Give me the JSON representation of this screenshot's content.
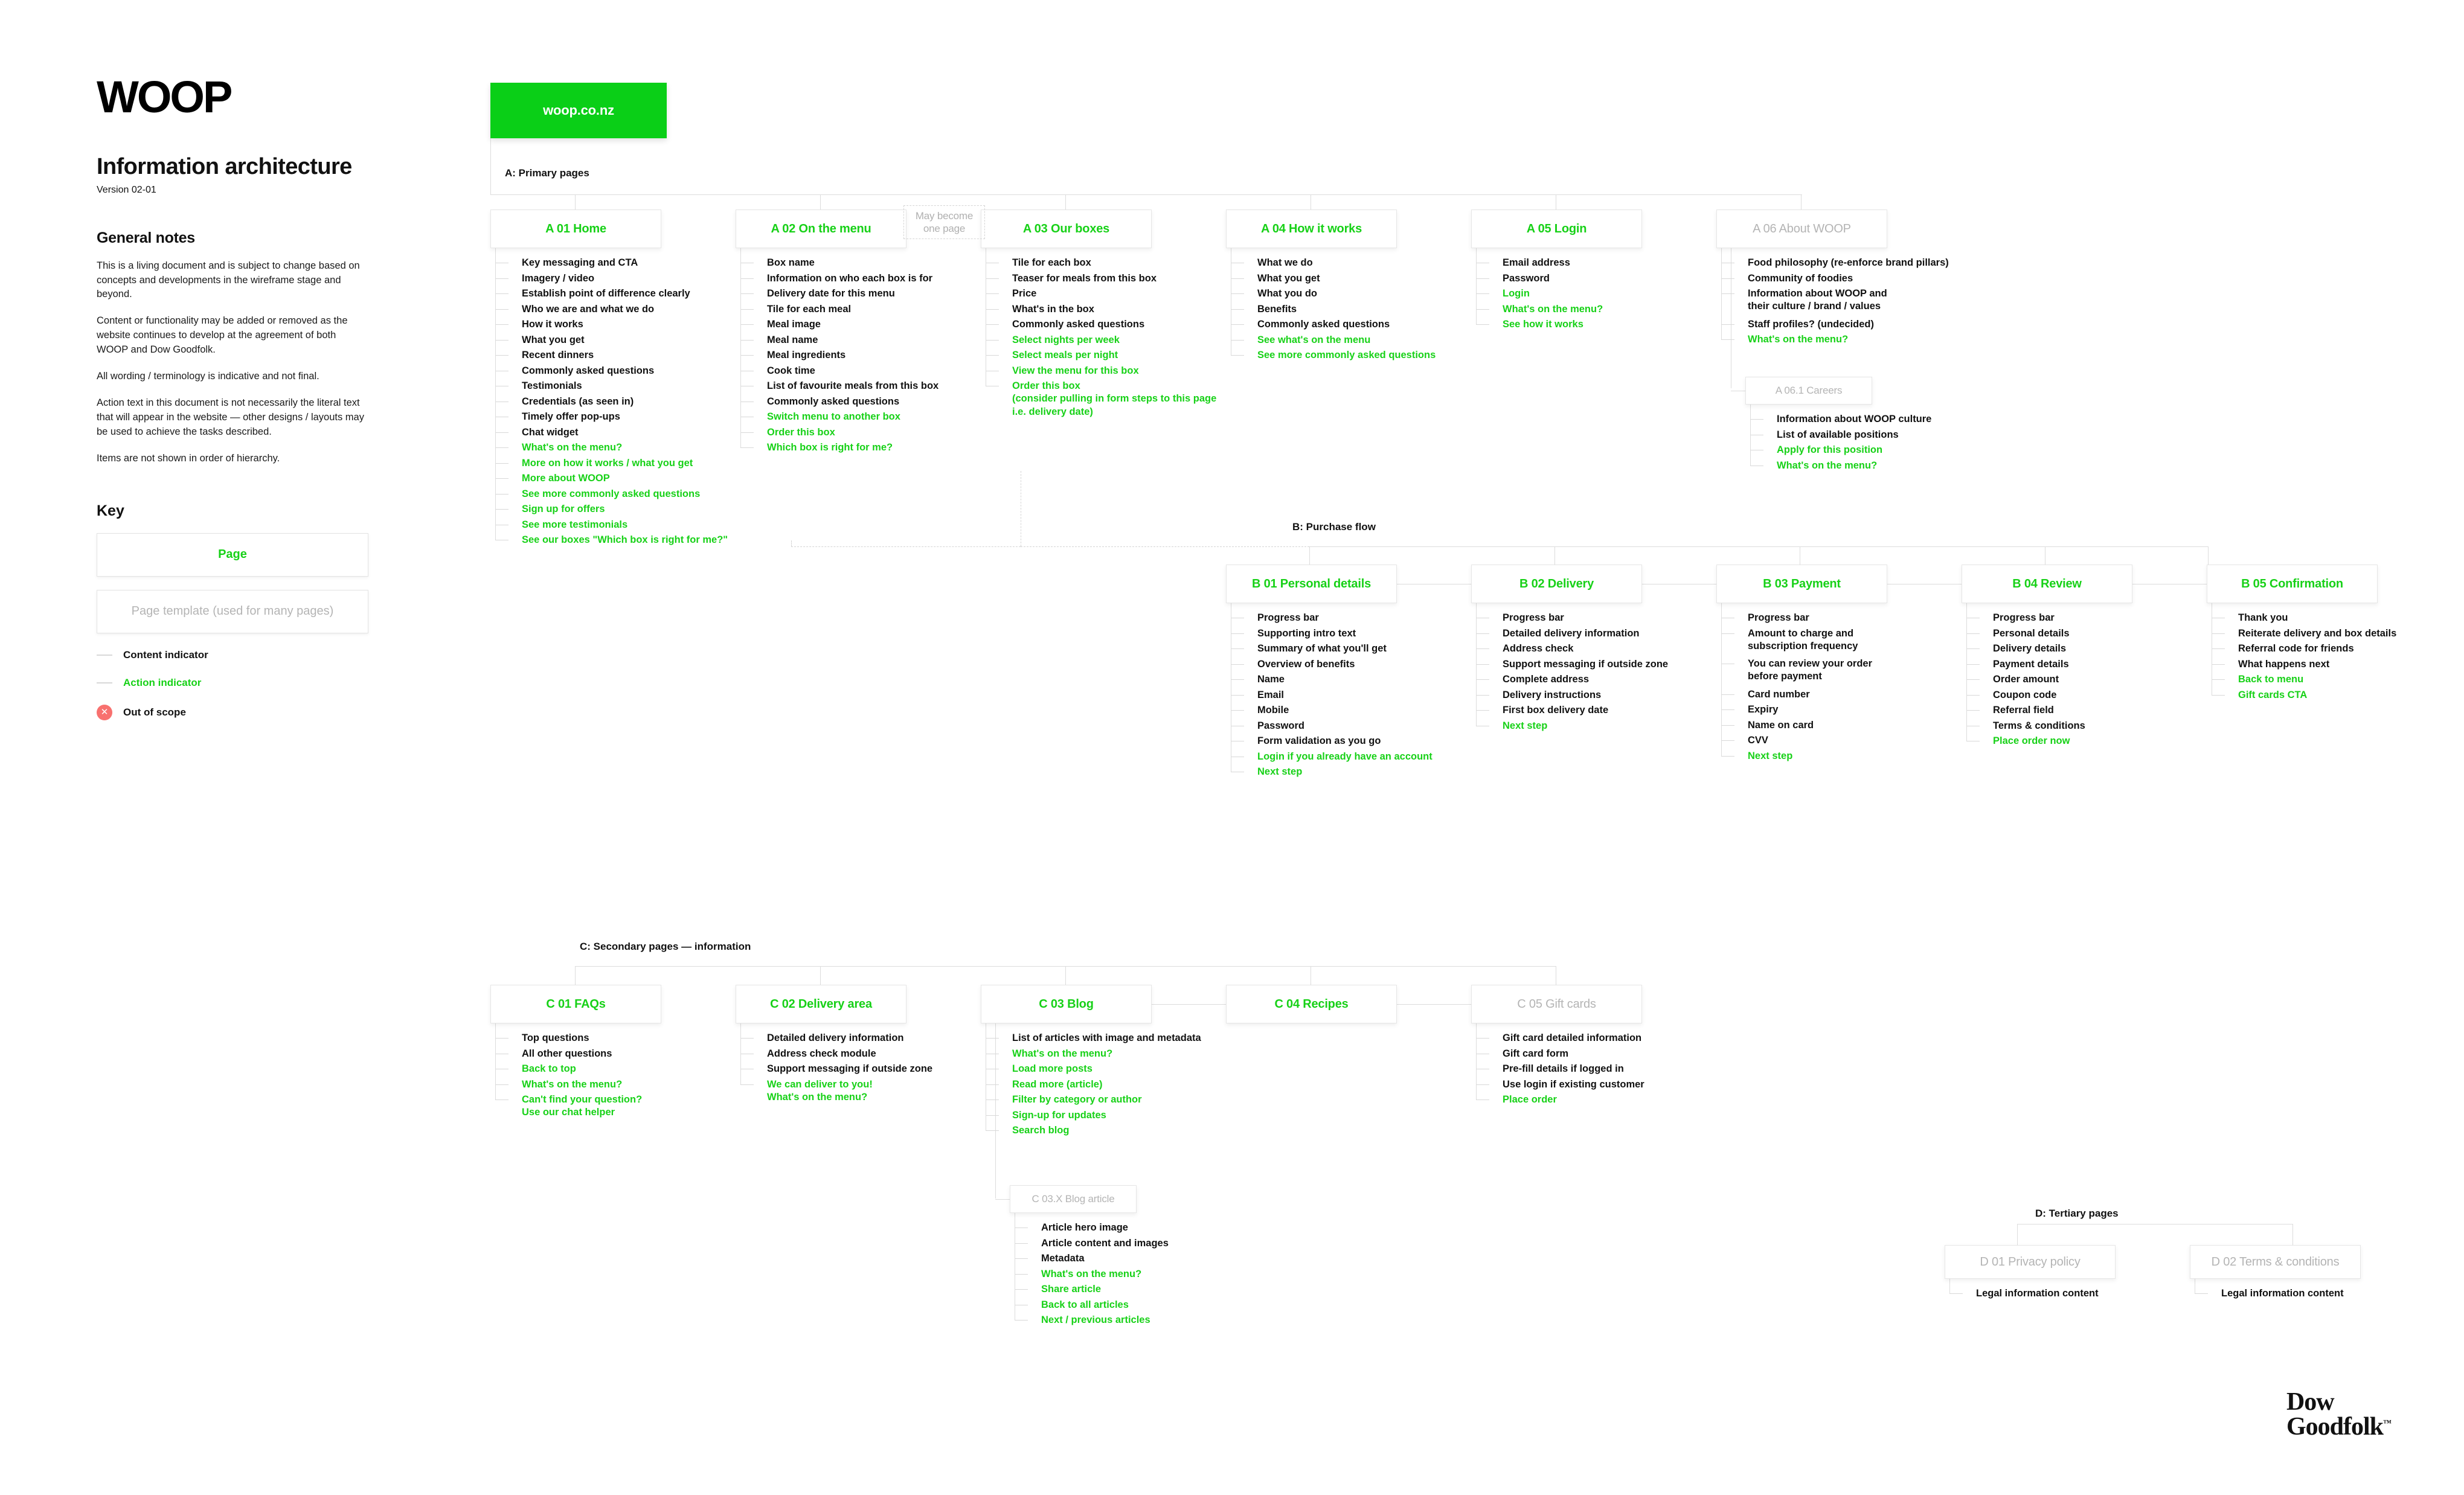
{
  "brand": {
    "logo": "WOOP"
  },
  "doc": {
    "title": "Information architecture",
    "version": "Version 02-01",
    "notes_heading": "General notes",
    "notes": [
      "This is a living document and is subject to change based on concepts and developments in the wireframe stage and beyond.",
      "Content or functionality may be added or removed as the website continues to develop at the agreement of both WOOP and Dow Goodfolk.",
      "All wording / terminology is indicative and not final.",
      "Action text in this document is not necessarily the literal text that will appear in the website — other designs / layouts may be used to achieve the tasks described.",
      "Items are not shown in order of hierarchy."
    ]
  },
  "key": {
    "heading": "Key",
    "page_box": "Page",
    "template_box": "Page template (used for many pages)",
    "content_indicator": "Content indicator",
    "action_indicator": "Action indicator",
    "out_of_scope": "Out of scope",
    "out_of_scope_icon": "close-icon"
  },
  "colors": {
    "action_green": "#17d117",
    "root_green": "#0ACF17",
    "template_grey": "#b4b4b4",
    "out_of_scope_red": "#f8716f",
    "line_grey": "#dcdcdc"
  },
  "root": {
    "label": "woop.co.nz"
  },
  "groups": {
    "a": "A: Primary pages",
    "b": "B: Purchase flow",
    "c": "C: Secondary pages — information",
    "d": "D: Tertiary pages"
  },
  "annotations": {
    "may_become_one_page": "May become\none page"
  },
  "nodes": {
    "a01": {
      "label": "A 01 Home",
      "items": [
        {
          "text": "Key messaging and CTA",
          "type": "content"
        },
        {
          "text": "Imagery / video",
          "type": "content"
        },
        {
          "text": "Establish point of difference clearly",
          "type": "content"
        },
        {
          "text": "Who we are and what we do",
          "type": "content"
        },
        {
          "text": "How it works",
          "type": "content"
        },
        {
          "text": "What you get",
          "type": "content"
        },
        {
          "text": "Recent dinners",
          "type": "content"
        },
        {
          "text": "Commonly asked questions",
          "type": "content"
        },
        {
          "text": "Testimonials",
          "type": "content"
        },
        {
          "text": "Credentials (as seen in)",
          "type": "content"
        },
        {
          "text": "Timely offer pop-ups",
          "type": "content"
        },
        {
          "text": "Chat widget",
          "type": "content"
        },
        {
          "text": "What's on the menu?",
          "type": "action"
        },
        {
          "text": "More on how it works / what you get",
          "type": "action"
        },
        {
          "text": "More about WOOP",
          "type": "action"
        },
        {
          "text": "See more commonly asked questions",
          "type": "action"
        },
        {
          "text": "Sign up for offers",
          "type": "action"
        },
        {
          "text": "See more testimonials",
          "type": "action"
        },
        {
          "text": "See our boxes \"Which box is right for me?\"",
          "type": "action"
        }
      ]
    },
    "a02": {
      "label": "A 02 On the menu",
      "items": [
        {
          "text": "Box name",
          "type": "content"
        },
        {
          "text": "Information on who each box is for",
          "type": "content"
        },
        {
          "text": "Delivery date for this menu",
          "type": "content"
        },
        {
          "text": "Tile for each meal",
          "type": "content"
        },
        {
          "text": "Meal image",
          "type": "content"
        },
        {
          "text": "Meal name",
          "type": "content"
        },
        {
          "text": "Meal ingredients",
          "type": "content"
        },
        {
          "text": "Cook time",
          "type": "content"
        },
        {
          "text": "List of favourite meals from this box",
          "type": "content"
        },
        {
          "text": "Commonly asked questions",
          "type": "content"
        },
        {
          "text": "Switch menu to another box",
          "type": "action"
        },
        {
          "text": "Order this box",
          "type": "action"
        },
        {
          "text": "Which box is right for me?",
          "type": "action"
        }
      ]
    },
    "a03": {
      "label": "A 03 Our boxes",
      "items": [
        {
          "text": "Tile for each box",
          "type": "content"
        },
        {
          "text": "Teaser for meals from this box",
          "type": "content"
        },
        {
          "text": "Price",
          "type": "content"
        },
        {
          "text": "What's in the box",
          "type": "content"
        },
        {
          "text": "Commonly asked questions",
          "type": "content"
        },
        {
          "text": "Select nights per week",
          "type": "action"
        },
        {
          "text": "Select meals per night",
          "type": "action"
        },
        {
          "text": "View the menu for this box",
          "type": "action"
        },
        {
          "text": "Order this box\n(consider pulling in form steps to this page\ni.e. delivery date)",
          "type": "action"
        }
      ]
    },
    "a04": {
      "label": "A 04 How it works",
      "items": [
        {
          "text": "What we do",
          "type": "content"
        },
        {
          "text": "What you get",
          "type": "content"
        },
        {
          "text": "What you do",
          "type": "content"
        },
        {
          "text": "Benefits",
          "type": "content"
        },
        {
          "text": "Commonly asked questions",
          "type": "content"
        },
        {
          "text": "See what's on the menu",
          "type": "action"
        },
        {
          "text": "See more commonly asked questions",
          "type": "action"
        }
      ]
    },
    "a05": {
      "label": "A 05 Login",
      "items": [
        {
          "text": "Email address",
          "type": "content"
        },
        {
          "text": "Password",
          "type": "content"
        },
        {
          "text": "Login",
          "type": "action"
        },
        {
          "text": "What's on the menu?",
          "type": "action"
        },
        {
          "text": "See how it works",
          "type": "action"
        }
      ]
    },
    "a06": {
      "label": "A 06 About WOOP",
      "template": true,
      "items": [
        {
          "text": "Food philosophy (re-enforce brand pillars)",
          "type": "content"
        },
        {
          "text": "Community of foodies",
          "type": "content"
        },
        {
          "text": "Information about WOOP and\ntheir culture / brand / values",
          "type": "content"
        },
        {
          "text": "Staff profiles? (undecided)",
          "type": "content"
        },
        {
          "text": "What's on the menu?",
          "type": "action"
        }
      ]
    },
    "a061": {
      "label": "A 06.1 Careers",
      "template": true,
      "items": [
        {
          "text": "Information about WOOP culture",
          "type": "content"
        },
        {
          "text": "List of available positions",
          "type": "content"
        },
        {
          "text": "Apply for this position",
          "type": "action"
        },
        {
          "text": "What's on the menu?",
          "type": "action"
        }
      ]
    },
    "b01": {
      "label": "B 01 Personal details",
      "items": [
        {
          "text": "Progress bar",
          "type": "content"
        },
        {
          "text": "Supporting intro text",
          "type": "content"
        },
        {
          "text": "Summary of what you'll get",
          "type": "content"
        },
        {
          "text": "Overview of benefits",
          "type": "content"
        },
        {
          "text": "Name",
          "type": "content"
        },
        {
          "text": "Email",
          "type": "content"
        },
        {
          "text": "Mobile",
          "type": "content"
        },
        {
          "text": "Password",
          "type": "content"
        },
        {
          "text": "Form validation as you go",
          "type": "content"
        },
        {
          "text": "Login if you already have an account",
          "type": "action"
        },
        {
          "text": "Next step",
          "type": "action"
        }
      ]
    },
    "b02": {
      "label": "B 02 Delivery",
      "items": [
        {
          "text": "Progress bar",
          "type": "content"
        },
        {
          "text": "Detailed delivery information",
          "type": "content"
        },
        {
          "text": "Address check",
          "type": "content"
        },
        {
          "text": "Support messaging if outside zone",
          "type": "content"
        },
        {
          "text": "Complete address",
          "type": "content"
        },
        {
          "text": "Delivery instructions",
          "type": "content"
        },
        {
          "text": "First box delivery date",
          "type": "content"
        },
        {
          "text": "Next step",
          "type": "action"
        }
      ]
    },
    "b03": {
      "label": "B 03 Payment",
      "items": [
        {
          "text": "Progress bar",
          "type": "content"
        },
        {
          "text": "Amount to charge and\nsubscription frequency",
          "type": "content"
        },
        {
          "text": "You can review your order\nbefore payment",
          "type": "content"
        },
        {
          "text": "Card number",
          "type": "content"
        },
        {
          "text": "Expiry",
          "type": "content"
        },
        {
          "text": "Name on card",
          "type": "content"
        },
        {
          "text": "CVV",
          "type": "content"
        },
        {
          "text": "Next step",
          "type": "action"
        }
      ]
    },
    "b04": {
      "label": "B 04 Review",
      "items": [
        {
          "text": "Progress bar",
          "type": "content"
        },
        {
          "text": "Personal details",
          "type": "content"
        },
        {
          "text": "Delivery details",
          "type": "content"
        },
        {
          "text": "Payment details",
          "type": "content"
        },
        {
          "text": "Order amount",
          "type": "content"
        },
        {
          "text": "Coupon code",
          "type": "content"
        },
        {
          "text": "Referral field",
          "type": "content"
        },
        {
          "text": "Terms & conditions",
          "type": "content"
        },
        {
          "text": "Place order now",
          "type": "action"
        }
      ]
    },
    "b05": {
      "label": "B 05 Confirmation",
      "items": [
        {
          "text": "Thank you",
          "type": "content"
        },
        {
          "text": "Reiterate delivery and box details",
          "type": "content"
        },
        {
          "text": "Referral code for friends",
          "type": "content"
        },
        {
          "text": "What happens next",
          "type": "content"
        },
        {
          "text": "Back to menu",
          "type": "action"
        },
        {
          "text": "Gift cards CTA",
          "type": "action"
        }
      ]
    },
    "c01": {
      "label": "C 01 FAQs",
      "items": [
        {
          "text": "Top questions",
          "type": "content"
        },
        {
          "text": "All other questions",
          "type": "content"
        },
        {
          "text": "Back to top",
          "type": "action"
        },
        {
          "text": "What's on the menu?",
          "type": "action"
        },
        {
          "text": "Can't find your question?\nUse our chat helper",
          "type": "action"
        }
      ]
    },
    "c02": {
      "label": "C 02 Delivery area",
      "items": [
        {
          "text": "Detailed delivery information",
          "type": "content"
        },
        {
          "text": "Address check module",
          "type": "content"
        },
        {
          "text": "Support messaging if outside zone",
          "type": "content"
        },
        {
          "text": "We can deliver to you!\nWhat's on the menu?",
          "type": "action"
        }
      ]
    },
    "c03": {
      "label": "C 03 Blog",
      "items": [
        {
          "text": "List of articles with image and metadata",
          "type": "content"
        },
        {
          "text": "What's on the menu?",
          "type": "action"
        },
        {
          "text": "Load more posts",
          "type": "action"
        },
        {
          "text": "Read more (article)",
          "type": "action"
        },
        {
          "text": "Filter by category or author",
          "type": "action"
        },
        {
          "text": "Sign-up for updates",
          "type": "action"
        },
        {
          "text": "Search blog",
          "type": "action"
        }
      ]
    },
    "c03x": {
      "label": "C 03.X Blog article",
      "template": true,
      "items": [
        {
          "text": "Article hero image",
          "type": "content"
        },
        {
          "text": "Article content and images",
          "type": "content"
        },
        {
          "text": "Metadata",
          "type": "content"
        },
        {
          "text": "What's on the menu?",
          "type": "action"
        },
        {
          "text": "Share article",
          "type": "action"
        },
        {
          "text": "Back to all articles",
          "type": "action"
        },
        {
          "text": "Next / previous articles",
          "type": "action"
        }
      ]
    },
    "c04": {
      "label": "C 04 Recipes",
      "items": []
    },
    "c05": {
      "label": "C 05 Gift cards",
      "template": true,
      "items": [
        {
          "text": "Gift card detailed information",
          "type": "content"
        },
        {
          "text": "Gift card form",
          "type": "content"
        },
        {
          "text": "Pre-fill details if logged in",
          "type": "content"
        },
        {
          "text": "Use login if existing customer",
          "type": "content"
        },
        {
          "text": "Place order",
          "type": "action"
        }
      ]
    },
    "d01": {
      "label": "D 01 Privacy policy",
      "template": true,
      "items": [
        {
          "text": "Legal information content",
          "type": "content"
        }
      ]
    },
    "d02": {
      "label": "D 02 Terms & conditions",
      "template": true,
      "items": [
        {
          "text": "Legal information content",
          "type": "content"
        }
      ]
    }
  },
  "footer": {
    "line1": "Dow",
    "line2": "Goodfolk",
    "tm": "™"
  }
}
